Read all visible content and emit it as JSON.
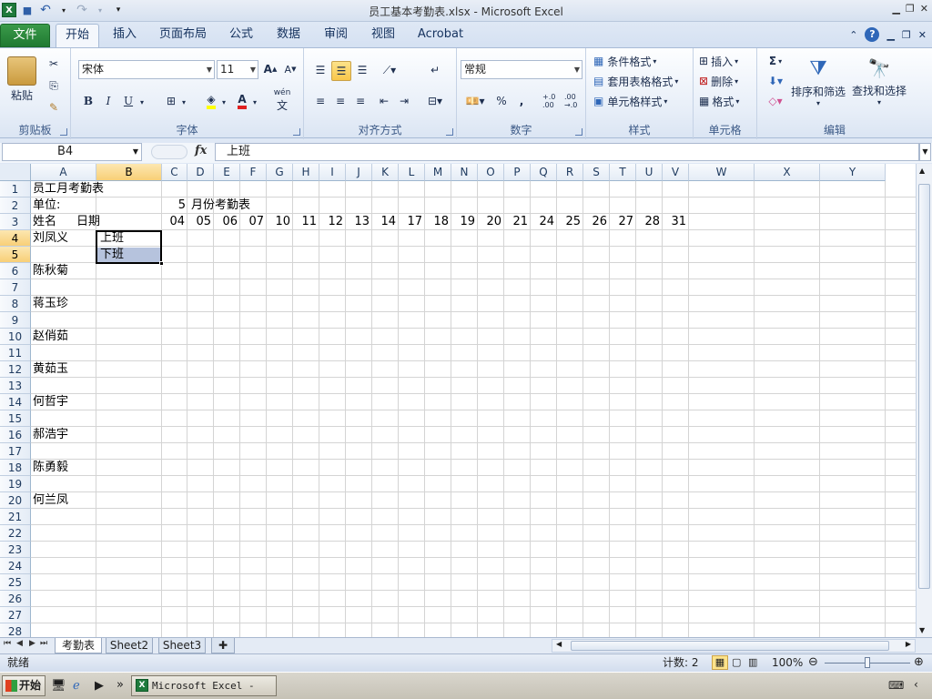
{
  "window": {
    "title": "员工基本考勤表.xlsx  -  Microsoft Excel",
    "qat_redo": "↷",
    "qat_undo": "↶"
  },
  "ribbon_tabs": [
    "文件",
    "开始",
    "插入",
    "页面布局",
    "公式",
    "数据",
    "审阅",
    "视图",
    "Acrobat"
  ],
  "active_tab": "开始",
  "ribbon": {
    "clipboard": {
      "paste": "粘贴",
      "label": "剪贴板"
    },
    "font": {
      "name": "宋体",
      "size": "11",
      "bold": "B",
      "italic": "I",
      "underline": "U",
      "label": "字体",
      "font_color_letter": "A",
      "wen": "wén"
    },
    "alignment": {
      "label": "对齐方式"
    },
    "number": {
      "format": "常规",
      "percent": "%",
      "comma": ",",
      "inc_dec": "+.0 .00",
      "dec_dec": ".00 →.0",
      "label": "数字"
    },
    "styles": {
      "conditional": "条件格式",
      "table": "套用表格格式",
      "cell": "单元格样式",
      "label": "样式"
    },
    "cells": {
      "insert": "插入",
      "delete": "删除",
      "format": "格式",
      "label": "单元格"
    },
    "editing": {
      "sigma": "Σ",
      "sort": "排序和筛选",
      "find": "查找和选择",
      "label": "编辑"
    }
  },
  "formula_bar": {
    "name_box": "B4",
    "fx": "fx",
    "formula": "上班"
  },
  "columns": [
    "A",
    "B",
    "C",
    "D",
    "E",
    "F",
    "G",
    "H",
    "I",
    "J",
    "K",
    "L",
    "M",
    "N",
    "O",
    "P",
    "Q",
    "R",
    "S",
    "T",
    "U",
    "V",
    "W",
    "X",
    "Y"
  ],
  "active_column": "B",
  "rows": [
    "1",
    "2",
    "3",
    "4",
    "5",
    "6",
    "7",
    "8",
    "9",
    "10",
    "11",
    "12",
    "13",
    "14",
    "15",
    "16",
    "17",
    "18",
    "19",
    "20",
    "21",
    "22",
    "23",
    "24",
    "25",
    "26",
    "27",
    "28"
  ],
  "active_rows": [
    "4",
    "5"
  ],
  "cells": {
    "A1": "员工月考勤表",
    "A2": "单位:",
    "C2": "5",
    "D2": "月份考勤表",
    "A3": "姓名",
    "A3b": "日期",
    "A4": "刘凤义",
    "A6": "陈秋菊",
    "A8": "蒋玉珍",
    "A10": "赵俏茹",
    "A12": "黄茹玉",
    "A14": "何哲宇",
    "A16": "郝浩宇",
    "A18": "陈勇毅",
    "A20": "何兰凤",
    "B4": "上班",
    "B5": "下班"
  },
  "dates": [
    "04",
    "05",
    "06",
    "07",
    "10",
    "11",
    "12",
    "13",
    "14",
    "17",
    "18",
    "19",
    "20",
    "21",
    "24",
    "25",
    "26",
    "27",
    "28",
    "31"
  ],
  "sheet_tabs": [
    "考勤表",
    "Sheet2",
    "Sheet3"
  ],
  "active_sheet": "考勤表",
  "status": {
    "ready": "就绪",
    "count": "计数: 2",
    "zoom": "100%"
  },
  "taskbar": {
    "start": "开始",
    "item": "Microsoft Excel - ...",
    "more": "»"
  },
  "colors": {
    "file_tab": "#207a32",
    "selection_highlight": "#f9c64a",
    "selected_cell_fill": "#b6c3dd"
  }
}
